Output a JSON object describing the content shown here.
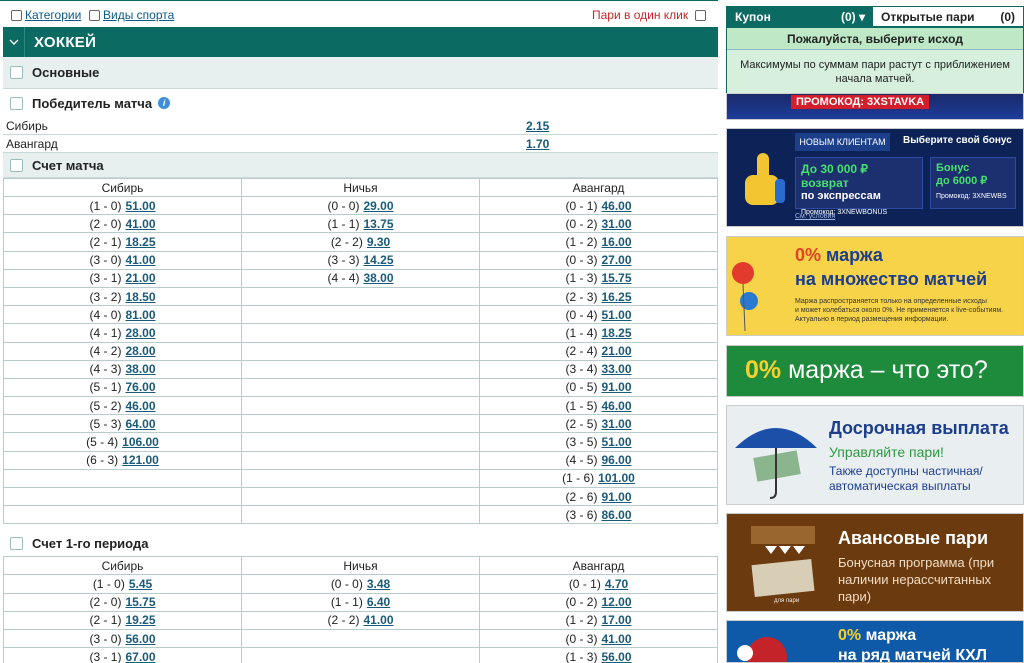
{
  "topbar": {
    "categories": "Категории",
    "sports": "Виды спорта",
    "one_click": "Пари в один клик"
  },
  "sport": {
    "title": "ХОККЕЙ"
  },
  "groups": {
    "main": "Основные",
    "winner": "Победитель матча",
    "score": "Счет матча",
    "score_p1": "Счет 1-го периода"
  },
  "winner": {
    "rows": [
      {
        "team": "Сибирь",
        "odd": "2.15"
      },
      {
        "team": "Авангард",
        "odd": "1.70"
      }
    ]
  },
  "score_table": {
    "headers": [
      "Сибирь",
      "Ничья",
      "Авангард"
    ],
    "rows": [
      [
        [
          "(1 - 0)",
          "51.00"
        ],
        [
          "(0 - 0)",
          "29.00"
        ],
        [
          "(0 - 1)",
          "46.00"
        ]
      ],
      [
        [
          "(2 - 0)",
          "41.00"
        ],
        [
          "(1 - 1)",
          "13.75"
        ],
        [
          "(0 - 2)",
          "31.00"
        ]
      ],
      [
        [
          "(2 - 1)",
          "18.25"
        ],
        [
          "(2 - 2)",
          "9.30"
        ],
        [
          "(1 - 2)",
          "16.00"
        ]
      ],
      [
        [
          "(3 - 0)",
          "41.00"
        ],
        [
          "(3 - 3)",
          "14.25"
        ],
        [
          "(0 - 3)",
          "27.00"
        ]
      ],
      [
        [
          "(3 - 1)",
          "21.00"
        ],
        [
          "(4 - 4)",
          "38.00"
        ],
        [
          "(1 - 3)",
          "15.75"
        ]
      ],
      [
        [
          "(3 - 2)",
          "18.50"
        ],
        [
          "",
          ""
        ],
        [
          "(2 - 3)",
          "16.25"
        ]
      ],
      [
        [
          "(4 - 0)",
          "81.00"
        ],
        [
          "",
          ""
        ],
        [
          "(0 - 4)",
          "51.00"
        ]
      ],
      [
        [
          "(4 - 1)",
          "28.00"
        ],
        [
          "",
          ""
        ],
        [
          "(1 - 4)",
          "18.25"
        ]
      ],
      [
        [
          "(4 - 2)",
          "28.00"
        ],
        [
          "",
          ""
        ],
        [
          "(2 - 4)",
          "21.00"
        ]
      ],
      [
        [
          "(4 - 3)",
          "38.00"
        ],
        [
          "",
          ""
        ],
        [
          "(3 - 4)",
          "33.00"
        ]
      ],
      [
        [
          "(5 - 1)",
          "76.00"
        ],
        [
          "",
          ""
        ],
        [
          "(0 - 5)",
          "91.00"
        ]
      ],
      [
        [
          "(5 - 2)",
          "46.00"
        ],
        [
          "",
          ""
        ],
        [
          "(1 - 5)",
          "46.00"
        ]
      ],
      [
        [
          "(5 - 3)",
          "64.00"
        ],
        [
          "",
          ""
        ],
        [
          "(2 - 5)",
          "31.00"
        ]
      ],
      [
        [
          "(5 - 4)",
          "106.00"
        ],
        [
          "",
          ""
        ],
        [
          "(3 - 5)",
          "51.00"
        ]
      ],
      [
        [
          "(6 - 3)",
          "121.00"
        ],
        [
          "",
          ""
        ],
        [
          "(4 - 5)",
          "96.00"
        ]
      ],
      [
        [
          "",
          ""
        ],
        [
          "",
          ""
        ],
        [
          "(1 - 6)",
          "101.00"
        ]
      ],
      [
        [
          "",
          ""
        ],
        [
          "",
          ""
        ],
        [
          "(2 - 6)",
          "91.00"
        ]
      ],
      [
        [
          "",
          ""
        ],
        [
          "",
          ""
        ],
        [
          "(3 - 6)",
          "86.00"
        ]
      ]
    ]
  },
  "score_p1_table": {
    "headers": [
      "Сибирь",
      "Ничья",
      "Авангард"
    ],
    "rows": [
      [
        [
          "(1 - 0)",
          "5.45"
        ],
        [
          "(0 - 0)",
          "3.48"
        ],
        [
          "(0 - 1)",
          "4.70"
        ]
      ],
      [
        [
          "(2 - 0)",
          "15.75"
        ],
        [
          "(1 - 1)",
          "6.40"
        ],
        [
          "(0 - 2)",
          "12.00"
        ]
      ],
      [
        [
          "(2 - 1)",
          "19.25"
        ],
        [
          "(2 - 2)",
          "41.00"
        ],
        [
          "(1 - 2)",
          "17.00"
        ]
      ],
      [
        [
          "(3 - 0)",
          "56.00"
        ],
        [
          "",
          ""
        ],
        [
          "(0 - 3)",
          "41.00"
        ]
      ],
      [
        [
          "(3 - 1)",
          "67.00"
        ],
        [
          "",
          ""
        ],
        [
          "(1 - 3)",
          "56.00"
        ]
      ]
    ]
  },
  "coupon": {
    "tab_coupon": "Купон",
    "tab_coupon_count": "(0)",
    "tab_open": "Открытые пари",
    "tab_open_count": "(0)",
    "choose": "Пожалуйста, выберите исход",
    "message": "Максимумы по суммам пари растут с приближением начала матчей."
  },
  "banners": {
    "b0_promo": "ПРОМОКОД: 3XSTAVKA",
    "b1_new": "НОВЫМ КЛИЕНТАМ",
    "b1_choose": "Выберите свой бонус",
    "b1_left_l1": "До 30 000 ₽ возврат",
    "b1_left_l2": "по экспрессам",
    "b1_left_code": "Промокод: 3XNEWBONUS",
    "b1_right_l1": "Бонус",
    "b1_right_l2": "до 6000 ₽",
    "b1_right_code": "Промокод: 3XNEWBS",
    "b1_terms": "См. условия",
    "b2_pct": "0%",
    "b2_l1": " маржа",
    "b2_l2": "на множество матчей",
    "b2_small1": "Маржа распространяется только на определенные исходы",
    "b2_small2": "и может колебаться около 0%. Не применяется к live-событиям.",
    "b2_small3": "Актуально в период размещения информации.",
    "b3_pct": "0%",
    "b3_text": " маржа – что это?",
    "b4_title": "Досрочная выплата",
    "b4_sub": "Управляйте пари!",
    "b4_l1": "Также доступны частичная/",
    "b4_l2": "автоматическая выплаты",
    "b5_title": "Авансовые пари",
    "b5_l1": "Бонусная программа (при",
    "b5_l2": "наличии нерассчитанных",
    "b5_l3": "пари)",
    "b5_small": "для пари",
    "b6_pct": "0%",
    "b6_l1": " маржа",
    "b6_l2": "на ряд матчей КХЛ"
  },
  "colors": {
    "accent": "#0b6b63",
    "odd_link": "#1a5a7a",
    "one_click": "#c62828"
  }
}
